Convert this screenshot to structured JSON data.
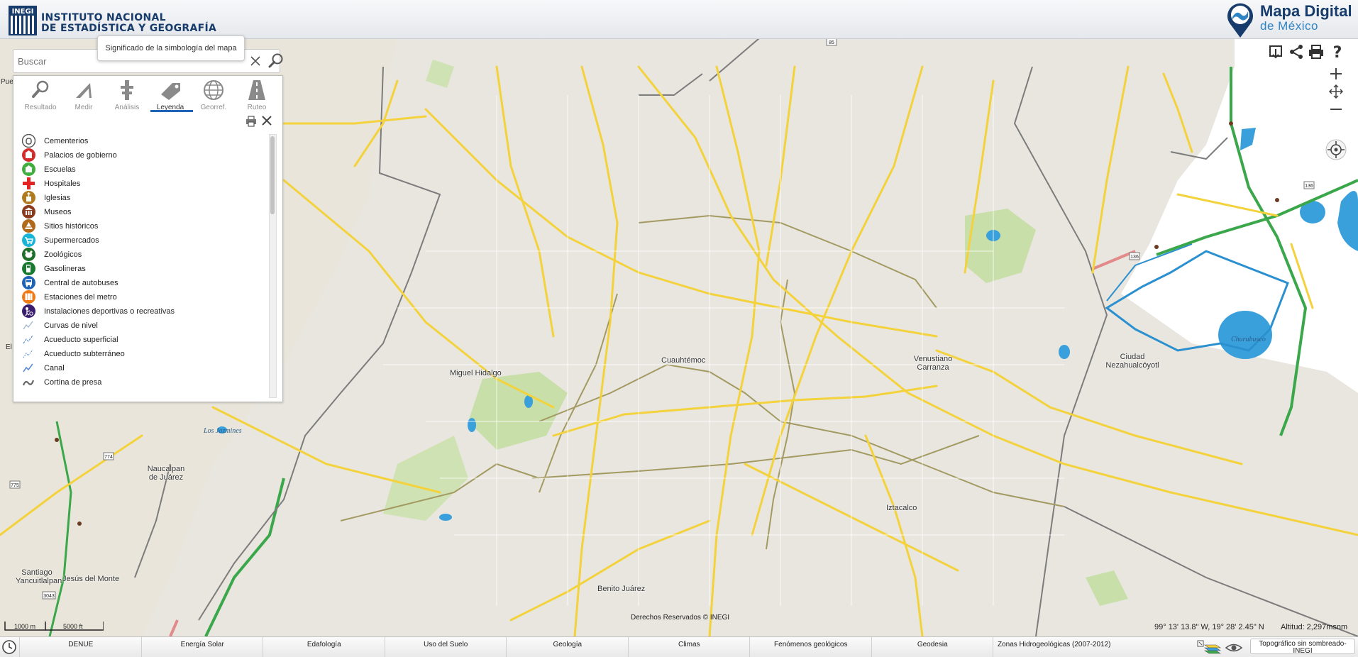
{
  "header": {
    "inegi_line1": "INSTITUTO NACIONAL",
    "inegi_line2": "DE ESTADÍSTICA Y GEOGRAFÍA",
    "inegi_mark": "INEGI",
    "app_title": "Mapa Digital",
    "app_subtitle": "de México"
  },
  "search": {
    "placeholder": "Buscar",
    "tooltip": "Significado de la simbología del mapa"
  },
  "panel": {
    "tabs": [
      {
        "label": "Resultado",
        "icon": "magnifier-icon"
      },
      {
        "label": "Medir",
        "icon": "ruler-icon"
      },
      {
        "label": "Análisis",
        "icon": "analysis-icon"
      },
      {
        "label": "Leyenda",
        "icon": "tag-icon",
        "active": true
      },
      {
        "label": "Georref.",
        "icon": "globe-icon"
      },
      {
        "label": "Ruteo",
        "icon": "road-icon"
      }
    ],
    "legend": [
      {
        "label": "Cementerios",
        "icon": "cemetery-icon",
        "color": "#555555"
      },
      {
        "label": "Palacios de gobierno",
        "icon": "government-icon",
        "color": "#d32a2a"
      },
      {
        "label": "Escuelas",
        "icon": "school-icon",
        "color": "#3fae3f"
      },
      {
        "label": "Hospitales",
        "icon": "hospital-icon",
        "color": "#e52222"
      },
      {
        "label": "Iglesias",
        "icon": "church-icon",
        "color": "#b07a1f"
      },
      {
        "label": "Museos",
        "icon": "museum-icon",
        "color": "#8b3a1e"
      },
      {
        "label": "Sitios históricos",
        "icon": "historic-icon",
        "color": "#b06a1a"
      },
      {
        "label": "Supermercados",
        "icon": "cart-icon",
        "color": "#19b5d8"
      },
      {
        "label": "Zoológicos",
        "icon": "zoo-icon",
        "color": "#1f6f2a"
      },
      {
        "label": "Gasolineras",
        "icon": "fuel-icon",
        "color": "#187a2e"
      },
      {
        "label": "Central de autobuses",
        "icon": "bus-icon",
        "color": "#1d63b8"
      },
      {
        "label": "Estaciones del metro",
        "icon": "metro-icon",
        "color": "#f07a15"
      },
      {
        "label": "Instalaciones deportivas o recreativas",
        "icon": "sports-icon",
        "color": "#3b1d6e"
      },
      {
        "label": "Curvas de nivel",
        "icon": "contour-icon",
        "color": "#9db0c8"
      },
      {
        "label": "Acueducto superficial",
        "icon": "aqueduct-icon",
        "color": "#5b8fd1"
      },
      {
        "label": "Acueducto subterráneo",
        "icon": "aqueduct-under-icon",
        "color": "#5b8fd1"
      },
      {
        "label": "Canal",
        "icon": "canal-icon",
        "color": "#5b8fd1"
      },
      {
        "label": "Cortina de presa",
        "icon": "dam-icon",
        "color": "#666666"
      }
    ]
  },
  "map": {
    "places": [
      {
        "text": "Cuauhtémoc"
      },
      {
        "text": "Miguel Hidalgo"
      },
      {
        "text": "Venustiano Carranza"
      },
      {
        "text": "Ciudad Nezahualcóyotl"
      },
      {
        "text": "Naucalpan de Juárez"
      },
      {
        "text": "Iztacalco"
      },
      {
        "text": "Benito Juárez"
      },
      {
        "text": "Santiago Yancuitlalpan"
      },
      {
        "text": "Jesús del Monte"
      }
    ],
    "water": [
      {
        "text": "Los Jazmines"
      },
      {
        "text": "Churubusco"
      }
    ],
    "shields": [
      "85",
      "136",
      "136",
      "774",
      "775",
      "3043"
    ],
    "edge_labels": [
      "Pue",
      "El"
    ]
  },
  "scale": {
    "metric": "1000 m",
    "imperial": "5000 ft"
  },
  "copyright": "Derechos Reservados © INEGI",
  "coords": "99° 13' 13.8\" W, 19° 28' 2.45\" N",
  "altitude": "Altitud: 2,297msnm",
  "bottom_bar": {
    "layers": [
      "DENUE",
      "Energía Solar",
      "Edafología",
      "Uso del Suelo",
      "Geología",
      "Climas",
      "Fenómenos geológicos",
      "Geodesia",
      "Zonas Hidrogeológicas (2007-2012)"
    ],
    "basemap": "Topográfico sin sombreado- INEGI"
  },
  "colors": {
    "brand": "#173c6b",
    "accent": "#1e65b7",
    "road": "#f3d23c",
    "water": "#3aa0dc",
    "park": "#c9dfa9"
  }
}
